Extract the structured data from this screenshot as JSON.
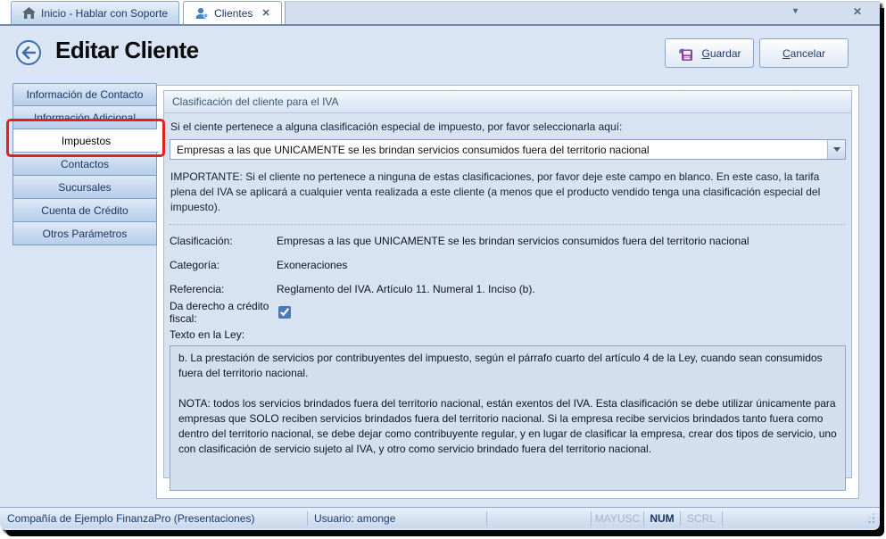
{
  "tabs": {
    "home_label": "Inicio - Hablar con Soporte",
    "clients_label": "Clientes",
    "close_glyph": "✕"
  },
  "window_controls": {
    "chevron": "▾",
    "close": "✕"
  },
  "header": {
    "title": "Editar Cliente"
  },
  "toolbar": {
    "save_label": "Guardar",
    "cancel_label": "Cancelar"
  },
  "sidebar": {
    "items": [
      {
        "label": "Información de Contacto",
        "active": false
      },
      {
        "label": "Información Adicional",
        "active": false
      },
      {
        "label": "Impuestos",
        "active": true
      },
      {
        "label": "Contactos",
        "active": false
      },
      {
        "label": "Sucursales",
        "active": false
      },
      {
        "label": "Cuenta de Crédito",
        "active": false
      },
      {
        "label": "Otros Parámetros",
        "active": false
      }
    ]
  },
  "panel": {
    "group_title": "Clasificación del cliente para el IVA",
    "select_prompt": "Si el ciente pertenece a alguna clasificación especial de impuesto, por favor seleccionarla aquí:",
    "select_value": "Empresas a las que UNICAMENTE se les brindan servicios consumidos fuera del territorio nacional",
    "important_note": "IMPORTANTE: Si el cliente no pertenece a ninguna de estas clasificaciones, por favor deje este campo en blanco. En este caso, la tarifa plena del IVA se aplicará a cualquier venta realizada a este cliente (a menos que el producto vendido tenga una clasificación especial del impuesto).",
    "fields": [
      {
        "label": "Clasificación:",
        "value": "Empresas a las que UNICAMENTE se les brindan servicios consumidos fuera del territorio nacional"
      },
      {
        "label": "Categoría:",
        "value": "Exoneraciones"
      },
      {
        "label": "Referencia:",
        "value": "Reglamento del IVA. Artículo 11. Numeral 1. Inciso (b)."
      }
    ],
    "checkbox_label": "Da derecho a crédito fiscal:",
    "checkbox_checked": true,
    "law_label": "Texto en la Ley:",
    "law_text_p1": "b. La prestación de servicios por contribuyentes del impuesto, según el párrafo cuarto del artículo 4 de la Ley, cuando sean consumidos fuera del territorio nacional.",
    "law_text_p2": "NOTA: todos los servicios brindados fuera del territorio nacional, están exentos del IVA. Esta clasificación se debe utilizar únicamente para empresas que SOLO reciben servicios brindados fuera del territorio nacional. Si la empresa recibe servicios brindados tanto fuera como dentro del territorio nacional, se debe dejar como contribuyente regular, y en lugar de clasificar la empresa, crear dos tipos de servicio, uno con clasificación de servicio sujeto al IVA, y otro como servicio brindado fuera del territorio nacional."
  },
  "statusbar": {
    "company": "Compañía de Ejemplo FinanzaPro (Presentaciones)",
    "user": "Usuario: amonge",
    "keys": [
      {
        "label": "MAYUSC",
        "active": false
      },
      {
        "label": "NUM",
        "active": true
      },
      {
        "label": "SCRL",
        "active": false
      }
    ]
  },
  "colors": {
    "annotation_red": "#e0241b",
    "body_blue": "#d9e5f4",
    "groupbox_blue": "#d8e3f2",
    "accent_navy": "#1c3c6b",
    "save_icon_purple": "#8a3fa8",
    "save_icon_blue": "#4a7ec2"
  }
}
